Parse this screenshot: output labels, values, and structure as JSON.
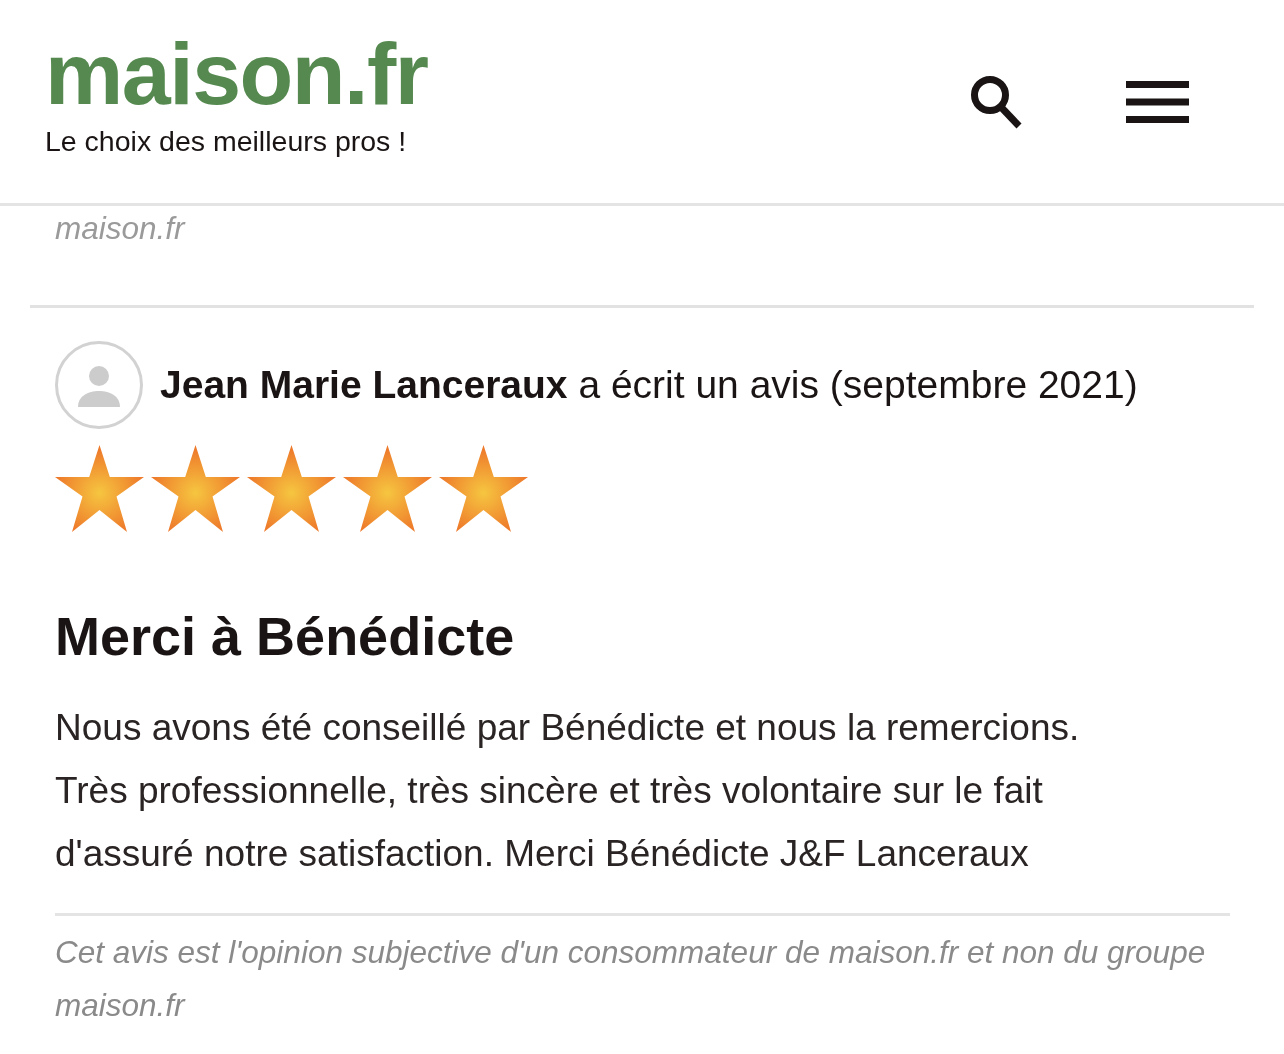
{
  "header": {
    "logo": "maison.fr",
    "tagline": "Le choix des meilleurs pros !"
  },
  "previous_review": {
    "disclaimer": "maison.fr"
  },
  "review": {
    "byline": "**Jean Marie Lanceraux** a écrit un avis (septembre 2021)",
    "stars": 5,
    "title": "Merci à Bénédicte",
    "body": "Nous avons été conseillé par Bénédicte et nous la remercions. Très professionnelle, très sincère et très volontaire sur le fait d'assuré notre satisfaction. Merci Bénédicte J&F Lanceraux",
    "disclaimer": "Cet avis est l'opinion subjective d'un consommateur de maison.fr et non du groupe maison.fr"
  }
}
